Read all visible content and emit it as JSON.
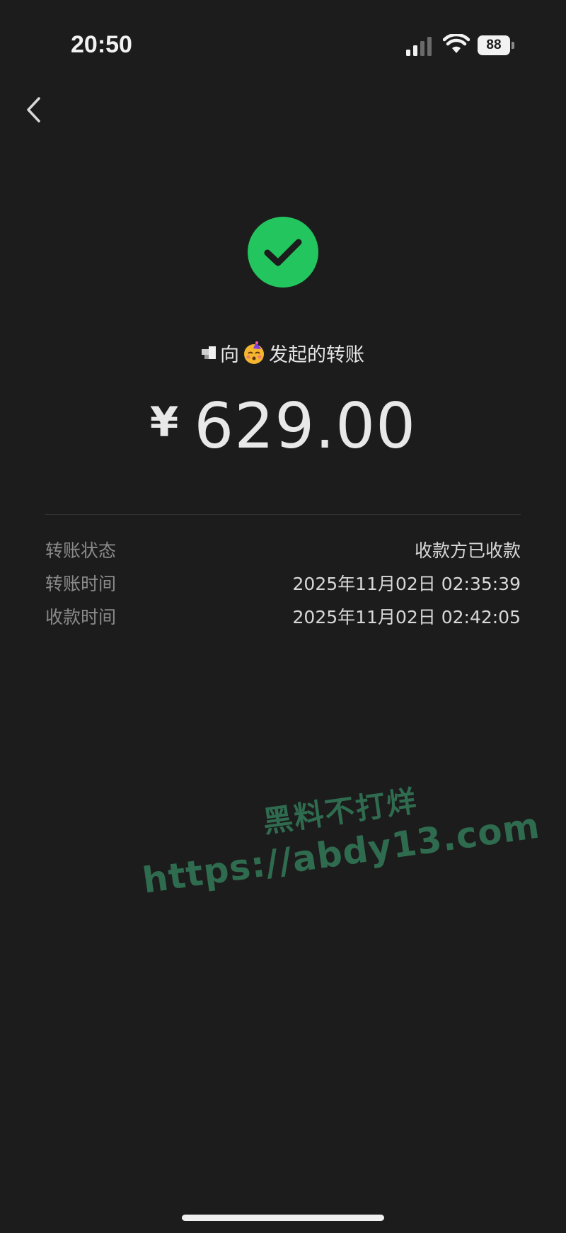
{
  "status_bar": {
    "time": "20:50",
    "battery_level": "88"
  },
  "transfer": {
    "direction_word": "向",
    "description_suffix": "发起的转账",
    "currency_symbol": "¥",
    "amount": "629.00"
  },
  "details": [
    {
      "label": "转账状态",
      "value": "收款方已收款"
    },
    {
      "label": "转账时间",
      "value": "2025年11月02日 02:35:39"
    },
    {
      "label": "收款时间",
      "value": "2025年11月02日 02:42:05"
    }
  ],
  "watermark": {
    "line1": "黑料不打烊",
    "line2": "https://abdy13.com"
  },
  "colors": {
    "background": "#1c1c1c",
    "success_green": "#22c55e",
    "watermark_green": "#2f6b4f"
  },
  "icons": {
    "back": "chevron-left-icon",
    "success": "check-circle-icon",
    "signal": "signal-bars-icon",
    "wifi": "wifi-icon",
    "battery": "battery-icon"
  }
}
